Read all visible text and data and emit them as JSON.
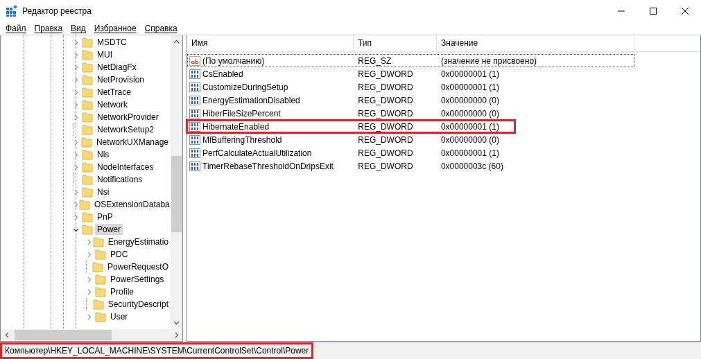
{
  "window": {
    "title": "Редактор реестра"
  },
  "menu": [
    "Файл",
    "Правка",
    "Вид",
    "Избранное",
    "Справка"
  ],
  "tree": {
    "items": [
      {
        "label": "MSDTC",
        "leaf": false,
        "expanded": false,
        "selected": false
      },
      {
        "label": "MUI",
        "leaf": false,
        "expanded": false,
        "selected": false
      },
      {
        "label": "NetDiagFx",
        "leaf": false,
        "expanded": false,
        "selected": false
      },
      {
        "label": "NetProvision",
        "leaf": false,
        "expanded": false,
        "selected": false
      },
      {
        "label": "NetTrace",
        "leaf": false,
        "expanded": false,
        "selected": false
      },
      {
        "label": "Network",
        "leaf": false,
        "expanded": false,
        "selected": false
      },
      {
        "label": "NetworkProvider",
        "leaf": false,
        "expanded": false,
        "selected": false
      },
      {
        "label": "NetworkSetup2",
        "leaf": true,
        "selected": false
      },
      {
        "label": "NetworkUXManage",
        "leaf": false,
        "expanded": false,
        "selected": false
      },
      {
        "label": "Nls",
        "leaf": false,
        "expanded": false,
        "selected": false
      },
      {
        "label": "NodeInterfaces",
        "leaf": false,
        "expanded": false,
        "selected": false
      },
      {
        "label": "Notifications",
        "leaf": true,
        "selected": false
      },
      {
        "label": "Nsi",
        "leaf": false,
        "expanded": false,
        "selected": false
      },
      {
        "label": "OSExtensionDataba",
        "leaf": false,
        "expanded": false,
        "selected": false
      },
      {
        "label": "PnP",
        "leaf": false,
        "expanded": false,
        "selected": false
      },
      {
        "label": "Power",
        "leaf": false,
        "expanded": true,
        "selected": true,
        "children": [
          {
            "label": "EnergyEstimatio",
            "leaf": false,
            "expanded": false,
            "selected": false
          },
          {
            "label": "PDC",
            "leaf": false,
            "expanded": false,
            "selected": false
          },
          {
            "label": "PowerRequestO",
            "leaf": true,
            "selected": false
          },
          {
            "label": "PowerSettings",
            "leaf": false,
            "expanded": false,
            "selected": false
          },
          {
            "label": "Profile",
            "leaf": false,
            "expanded": false,
            "selected": false
          },
          {
            "label": "SecurityDescript",
            "leaf": true,
            "selected": false
          },
          {
            "label": "User",
            "leaf": false,
            "expanded": false,
            "selected": false
          }
        ]
      }
    ]
  },
  "table": {
    "columns": [
      "Имя",
      "Тип",
      "Значение"
    ],
    "rows": [
      {
        "kind": "string",
        "name": "(По умолчанию)",
        "type": "REG_SZ",
        "value": "(значение не присвоено)",
        "focused": true,
        "annotated": false
      },
      {
        "kind": "binary",
        "name": "CsEnabled",
        "type": "REG_DWORD",
        "value": "0x00000001 (1)",
        "focused": false,
        "annotated": false
      },
      {
        "kind": "binary",
        "name": "CustomizeDuringSetup",
        "type": "REG_DWORD",
        "value": "0x00000001 (1)",
        "focused": false,
        "annotated": false
      },
      {
        "kind": "binary",
        "name": "EnergyEstimationDisabled",
        "type": "REG_DWORD",
        "value": "0x00000000 (0)",
        "focused": false,
        "annotated": false
      },
      {
        "kind": "binary",
        "name": "HiberFileSizePercent",
        "type": "REG_DWORD",
        "value": "0x00000000 (0)",
        "focused": false,
        "annotated": false
      },
      {
        "kind": "binary",
        "name": "HibernateEnabled",
        "type": "REG_DWORD",
        "value": "0x00000001 (1)",
        "focused": false,
        "annotated": true
      },
      {
        "kind": "binary",
        "name": "MfBufferingThreshold",
        "type": "REG_DWORD",
        "value": "0x00000000 (0)",
        "focused": false,
        "annotated": false
      },
      {
        "kind": "binary",
        "name": "PerfCalculateActualUtilization",
        "type": "REG_DWORD",
        "value": "0x00000001 (1)",
        "focused": false,
        "annotated": false
      },
      {
        "kind": "binary",
        "name": "TimerRebaseThresholdOnDripsExit",
        "type": "REG_DWORD",
        "value": "0x0000003c (60)",
        "focused": false,
        "annotated": false
      }
    ]
  },
  "status_bar": {
    "path": "Компьютер\\HKEY_LOCAL_MACHINE\\SYSTEM\\CurrentControlSet\\Control\\Power",
    "annotated": true
  }
}
